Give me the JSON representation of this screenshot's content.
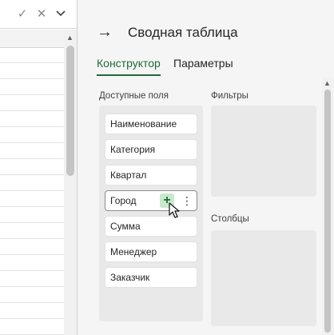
{
  "formula_bar": {
    "confirm_icon": "check-icon",
    "cancel_icon": "close-icon",
    "expand_icon": "chevron-down-icon"
  },
  "pane": {
    "back_icon": "arrow-right-icon",
    "title": "Сводная таблица",
    "tabs": [
      {
        "label": "Конструктор",
        "active": true
      },
      {
        "label": "Параметры",
        "active": false
      }
    ],
    "available_fields_label": "Доступные поля",
    "filters_label": "Фильтры",
    "columns_label": "Столбцы",
    "fields": [
      {
        "label": "Наименование"
      },
      {
        "label": "Категория"
      },
      {
        "label": "Квартал"
      },
      {
        "label": "Город",
        "hovered": true
      },
      {
        "label": "Сумма"
      },
      {
        "label": "Менеджер"
      },
      {
        "label": "Заказчик"
      }
    ],
    "add_icon": "plus-icon",
    "more_icon": "more-vertical-icon"
  },
  "colors": {
    "accent": "#1d6b37",
    "add_button_bg": "#c9e8cd",
    "pane_bg": "#f5f5f5",
    "box_bg": "#e9e9e9"
  }
}
